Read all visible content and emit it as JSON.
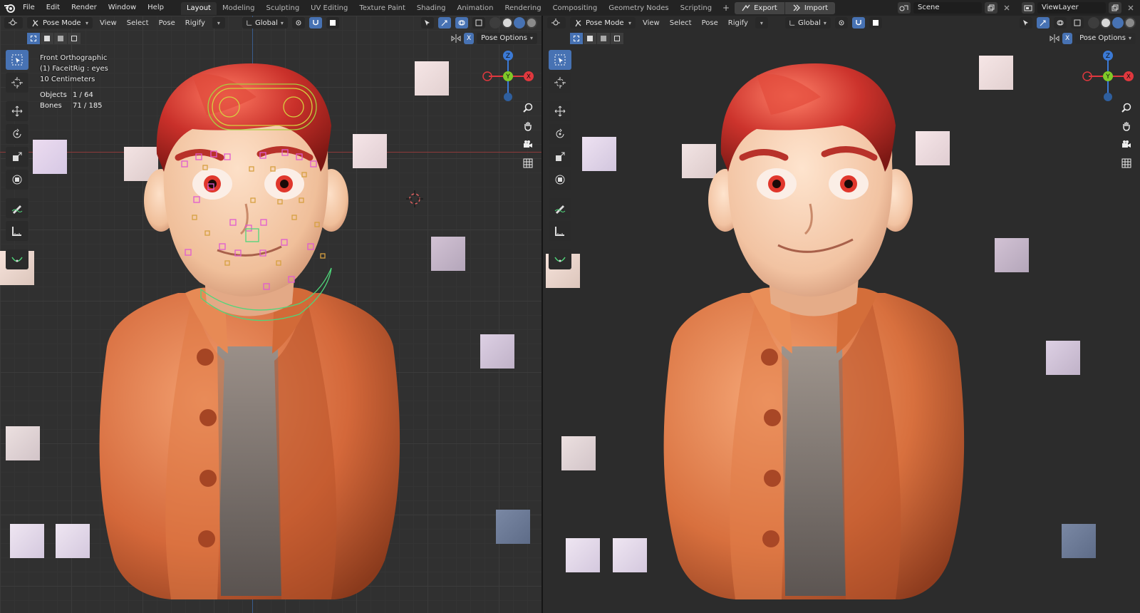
{
  "menus": [
    "File",
    "Edit",
    "Render",
    "Window",
    "Help"
  ],
  "workspaces": [
    "Layout",
    "Modeling",
    "Sculpting",
    "UV Editing",
    "Texture Paint",
    "Shading",
    "Animation",
    "Rendering",
    "Compositing",
    "Geometry Nodes",
    "Scripting"
  ],
  "active_workspace": "Layout",
  "workspace_add": "+",
  "extra_buttons": {
    "export": "Export",
    "import": "Import"
  },
  "scene": {
    "name": "Scene",
    "view_layer": "ViewLayer"
  },
  "viewport_header": {
    "mode": "Pose Mode",
    "menu": [
      "View",
      "Select",
      "Pose",
      "Rigify"
    ],
    "orientation": "Global",
    "pose_options": "Pose Options"
  },
  "viewport_info": {
    "view": "Front Orthographic",
    "active": "(1) FaceitRig : eyes",
    "scale": "10 Centimeters",
    "objects_label": "Objects",
    "objects_value": "1 / 64",
    "bones_label": "Bones",
    "bones_value": "71 / 185"
  },
  "gizmo_axes": {
    "z": "Z",
    "y": "Y",
    "x": "X"
  },
  "colors": {
    "accent_blue": "#4772b3",
    "axis_x": "#e0383e",
    "axis_y": "#7fca28",
    "axis_z": "#3b7ad6",
    "hair": "#c2302c",
    "jacket": "#d96a33",
    "shirt": "#6e6764",
    "skin": "#f2c3a2",
    "rig_magenta": "#e05bd0",
    "rig_yellow": "#d6d040",
    "rig_green": "#4fd67a"
  }
}
